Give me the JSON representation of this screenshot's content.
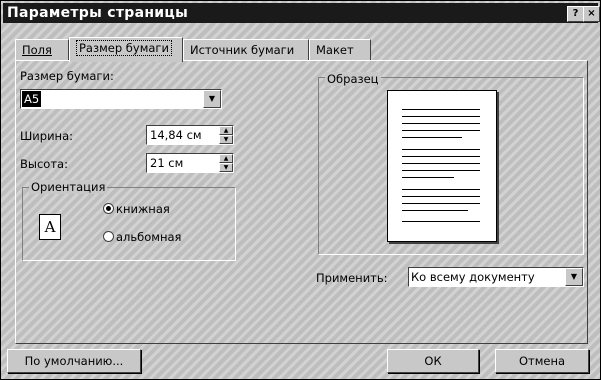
{
  "window": {
    "title": "Параметры страницы",
    "help_glyph": "?",
    "close_glyph": "×"
  },
  "tabs": [
    {
      "label": "Поля",
      "active": false
    },
    {
      "label": "Размер бумаги",
      "active": true
    },
    {
      "label": "Источник бумаги",
      "active": false
    },
    {
      "label": "Макет",
      "active": false
    }
  ],
  "paper_size": {
    "label": "Размер бумаги:",
    "value": "A5"
  },
  "width": {
    "label": "Ширина:",
    "value": "14,84 см"
  },
  "height": {
    "label": "Высота:",
    "value": "21 см"
  },
  "orientation": {
    "legend": "Ориентация",
    "icon_letter": "A",
    "options": [
      {
        "label": "книжная",
        "selected": true
      },
      {
        "label": "альбомная",
        "selected": false
      }
    ]
  },
  "preview": {
    "label": "Образец"
  },
  "apply": {
    "label": "Применить:",
    "value": "Ко всему документу"
  },
  "buttons": {
    "default": "По умолчанию...",
    "ok": "ОК",
    "cancel": "Отмена"
  },
  "colors": {
    "face": "#c8c8c8",
    "titlebar": "#1a1a1a",
    "selection": "#000000"
  }
}
